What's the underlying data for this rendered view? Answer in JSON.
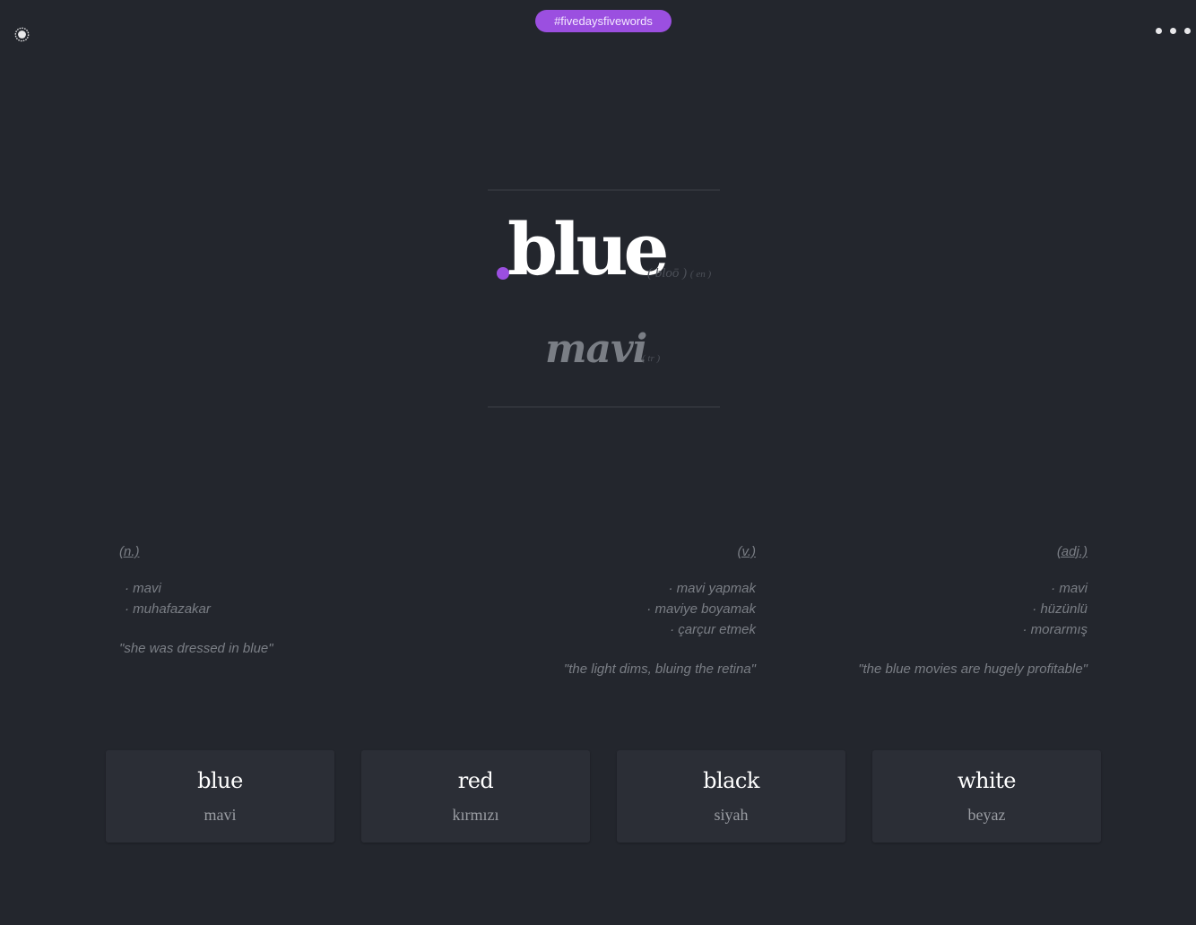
{
  "header": {
    "hashtag": "#fivedaysfivewords",
    "theme_icon": "sun-icon",
    "more_icon": "more-dots-icon"
  },
  "word": {
    "text": "blue",
    "pronunciation": "( bloō )",
    "lang": "( en )",
    "translation": "mavi",
    "translation_lang": "( tr )"
  },
  "definitions": [
    {
      "pos": "(n.)",
      "meanings": [
        "· mavi",
        "· muhafazakar"
      ],
      "example": "\"she was dressed in blue\""
    },
    {
      "pos": "(v.)",
      "meanings": [
        "·  mavi yapmak",
        "·  maviye boyamak",
        "·  çarçur etmek"
      ],
      "example": "\"the light dims, bluing the retina\""
    },
    {
      "pos": "(adj.)",
      "meanings": [
        "·  mavi",
        "·  hüzünlü",
        "·  morarmış"
      ],
      "example": "\"the blue movies are hugely profitable\""
    }
  ],
  "cards": [
    {
      "en": "blue",
      "tr": "mavi"
    },
    {
      "en": "red",
      "tr": "kırmızı"
    },
    {
      "en": "black",
      "tr": "siyah"
    },
    {
      "en": "white",
      "tr": "beyaz"
    }
  ],
  "colors": {
    "accent": "#9b4fe0",
    "background": "#23262d",
    "card": "#2b2e36",
    "muted_text": "#7a7e85"
  }
}
